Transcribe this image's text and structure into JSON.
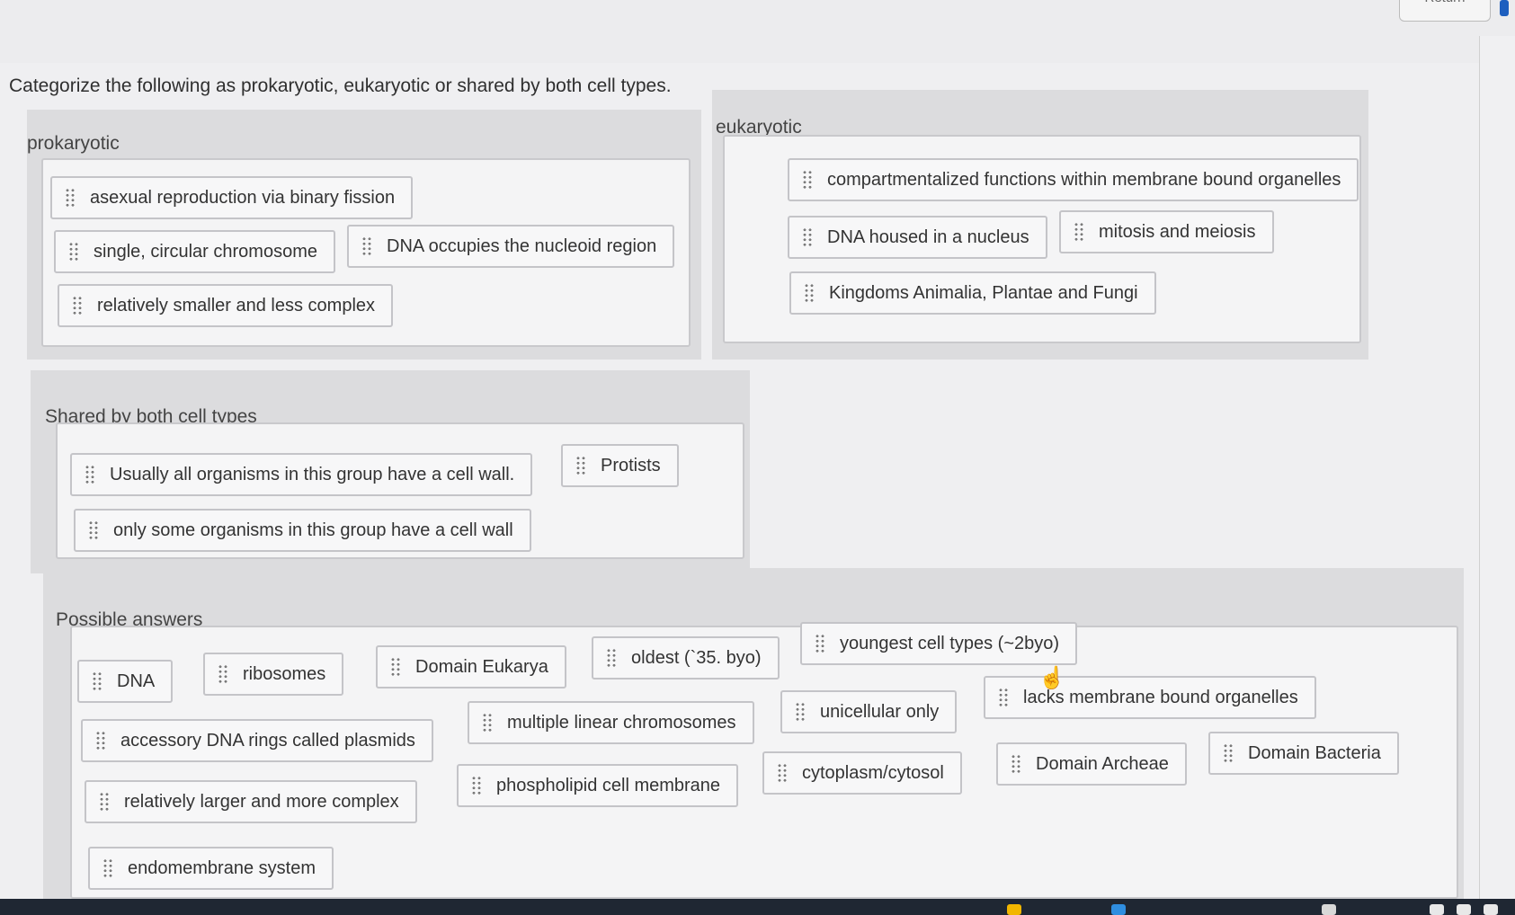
{
  "header": {
    "return_label": "Return"
  },
  "question": "Categorize the following as prokaryotic, eukaryotic or shared by both cell types.",
  "zones": {
    "prokaryotic": {
      "title": "prokaryotic",
      "items": [
        "asexual reproduction via binary fission",
        "single, circular chromosome",
        "DNA occupies the nucleoid region",
        "relatively smaller and less complex"
      ]
    },
    "eukaryotic": {
      "title": "eukaryotic",
      "items": [
        "compartmentalized functions within membrane bound organelles",
        "DNA housed in a nucleus",
        "mitosis and meiosis",
        "Kingdoms Animalia, Plantae and Fungi"
      ]
    },
    "shared": {
      "title": "Shared by both cell types",
      "items": [
        "Usually all organisms in this group have a cell wall.",
        "Protists",
        "only some organisms in this group have a cell wall"
      ]
    },
    "possible": {
      "title": "Possible answers",
      "items": [
        "DNA",
        "ribosomes",
        "Domain Eukarya",
        "oldest (`35. byo)",
        "youngest cell types (~2byo)",
        "accessory DNA rings called plasmids",
        "multiple linear chromosomes",
        "unicellular only",
        "lacks membrane bound organelles",
        "relatively larger and more complex",
        "phospholipid cell membrane",
        "cytoplasm/cytosol",
        "Domain Archeae",
        "Domain Bacteria",
        "endomembrane system"
      ]
    }
  },
  "icons": {
    "drag_handle": "drag-handle-icon",
    "cursor": "hand-pointer-icon"
  },
  "colors": {
    "accent": "#1e5fbf",
    "chip_border": "#c4c4c8",
    "zone_bg": "#dcdcde"
  }
}
